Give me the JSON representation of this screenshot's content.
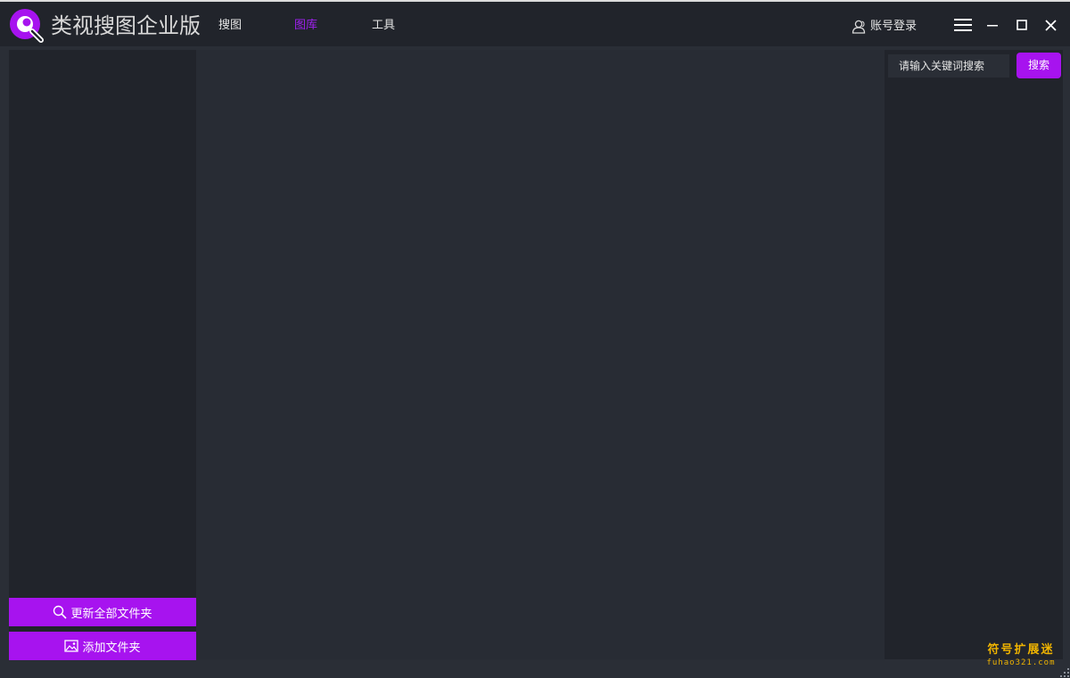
{
  "app": {
    "title": "类视搜图企业版"
  },
  "nav": {
    "tabs": [
      {
        "label": "搜图",
        "active": false
      },
      {
        "label": "图库",
        "active": true
      },
      {
        "label": "工具",
        "active": false
      }
    ]
  },
  "header": {
    "login_label": "账号登录"
  },
  "search": {
    "placeholder": "请输入关键词搜索",
    "button_label": "搜索"
  },
  "left_panel": {
    "update_all_label": "更新全部文件夹",
    "add_folder_label": "添加文件夹"
  },
  "watermark": {
    "cn": "符号扩展迷",
    "en": "fuhao321.com"
  },
  "icons": {
    "logo": "magnifier-logo-icon",
    "user": "user-icon",
    "menu": "hamburger-menu-icon",
    "minimize": "minimize-icon",
    "maximize": "maximize-icon",
    "close": "close-icon",
    "search": "search-icon",
    "image": "image-icon"
  },
  "colors": {
    "accent": "#a713ef",
    "active_tab": "#a020f0",
    "titlebar_bg": "#21242b",
    "panel_bg": "#21242b",
    "main_bg": "#282c34",
    "watermark": "#f0b400"
  }
}
